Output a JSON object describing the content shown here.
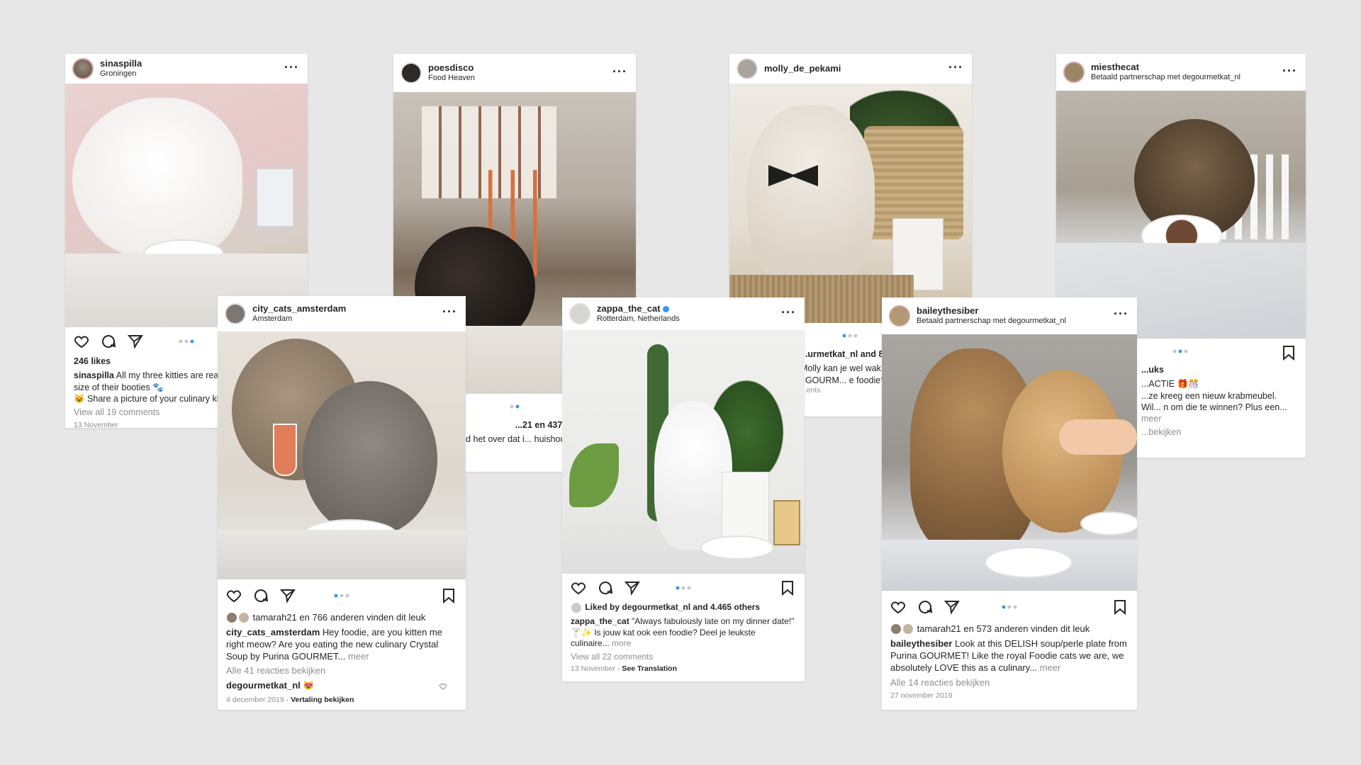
{
  "posts": [
    {
      "username": "sinaspilla",
      "location": "Groningen",
      "likes": "246 likes",
      "caption_user": "sinaspilla",
      "caption": "All my three kitties are real f... can see by the size of their booties 🐾",
      "caption_line3": "😺 Share a picture of your culinary kit...",
      "comments": "View all 19 comments",
      "date": "13 November"
    },
    {
      "username": "poesdisco",
      "location": "Food Heaven",
      "likes": "...21 en 437 anderen vind...",
      "caption": "...uwtje had het over dat i... huishouden wat belac..."
    },
    {
      "username": "molly_de_pekami",
      "likes": "...urmetkat_nl and 86...",
      "caption": "Molly kan je wel wak... maaltijd van #GOURM... e foodie? Deel dan j...",
      "comments": "...ents"
    },
    {
      "username": "miesthecat",
      "location": "Betaald partnerschap met degourmetkat_nl",
      "likes": "...uks",
      "caption": "...ACTIE 🎁🎊",
      "caption2": "...ze kreeg een nieuw krabmeubel. Wil... n om die te winnen? Plus een...",
      "more": "meer",
      "comments": "...bekijken"
    },
    {
      "username": "city_cats_amsterdam",
      "location": "Amsterdam",
      "likes": "tamarah21 en 766 anderen vinden dit leuk",
      "caption_user": "city_cats_amsterdam",
      "caption": "Hey foodie, are you kitten me right meow? Are you eating the new culinary Crystal Soup by Purina GOURMET...",
      "more": "meer",
      "comments": "Alle 41 reacties bekijken",
      "reply_user": "degourmetkat_nl",
      "reply": "😻",
      "date": "4 december 2019",
      "translate": "Vertaling bekijken"
    },
    {
      "username": "zappa_the_cat",
      "location": "Rotterdam, Netherlands",
      "likes": "Liked by degourmetkat_nl and 4.465 others",
      "caption_user": "zappa_the_cat",
      "caption": "\"Always fabulously late on my dinner date!\" 🍸✨ Is jouw kat ook een foodie? Deel je leukste culinaire...",
      "more": "more",
      "comments": "View all 22 comments",
      "date": "13 November",
      "translate": "See Translation"
    },
    {
      "username": "baileythesiber",
      "location": "Betaald partnerschap met degourmetkat_nl",
      "likes": "tamarah21 en 573 anderen vinden dit leuk",
      "caption_user": "baileythesiber",
      "caption": "Look at this DELISH soup/perle plate from Purina GOURMET! Like the royal Foodie cats we are, we absolutely LOVE this as a culinary...",
      "more": "meer",
      "comments": "Alle 14 reacties bekijken",
      "date": "27 november 2019"
    }
  ],
  "icons": [
    "heart-icon",
    "comment-icon",
    "share-icon",
    "bookmark-icon",
    "more-icon"
  ],
  "colors": {
    "background": "#e7e7e7",
    "accent": "#3897f0",
    "muted": "#8e8e8e"
  }
}
